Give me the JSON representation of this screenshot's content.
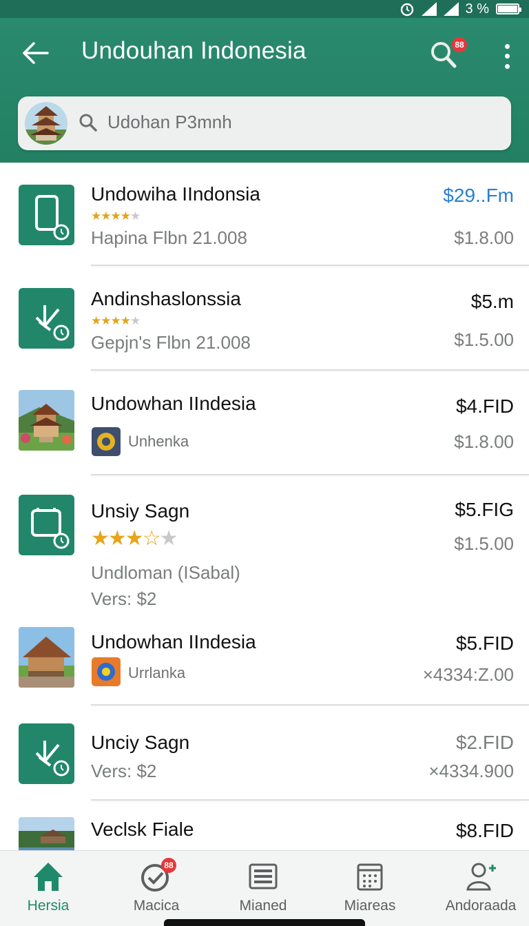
{
  "status_bar": {
    "battery": "3 %"
  },
  "app_bar": {
    "title": "Undouhan Indonesia",
    "search_badge": "88",
    "search_placeholder": "Udohan P3mnh"
  },
  "colors": {
    "primary": "#238062",
    "accent_price": "#2b7fd0",
    "badge": "#e5383b",
    "star": "#e6a51a"
  },
  "items": [
    {
      "name": "Undowiha IIndonsia",
      "rating": 3.5,
      "sub": "Hapina Flbn 21.008",
      "price": "$29..Fm",
      "price2": "$1.8.00",
      "icon": "phone-app-icon"
    },
    {
      "name": "Andinshaslonssia",
      "rating": 3.5,
      "sub": "Gepjn's Flbn 21.008",
      "price": "$5.m",
      "price2": "$1.5.00",
      "icon": "download-app-icon"
    },
    {
      "name": "Undowhan IIndesia",
      "sub": "Unhenka",
      "price": "$4.FID",
      "price2": "$1.8.00",
      "icon": "pagoda-photo"
    },
    {
      "name": "Unsiy Sagn",
      "rating": 3.5,
      "sub": "Undloman (ISabal)",
      "sub2": "Vers: $2",
      "price": "$5.FIG",
      "price2": "$1.5.00",
      "icon": "tablet-app-icon"
    },
    {
      "name": "Undowhan IIndesia",
      "sub": "Urrlanka",
      "price": "$5.FID",
      "price2": "×4334:Z.00",
      "icon": "hut-photo"
    },
    {
      "name": "Unciy Sagn",
      "sub": "Vers: $2",
      "price": "$2.FID",
      "price2": "×4334.900",
      "icon": "download-app-icon"
    },
    {
      "name": "Veclsk Fiale",
      "price": "$8.FID",
      "icon": "lake-photo"
    }
  ],
  "nav": {
    "items": [
      {
        "label": "Hersia",
        "active": true
      },
      {
        "label": "Macica",
        "badge": "88"
      },
      {
        "label": "Mianed"
      },
      {
        "label": "Miareas"
      },
      {
        "label": "Andoraada"
      }
    ]
  }
}
